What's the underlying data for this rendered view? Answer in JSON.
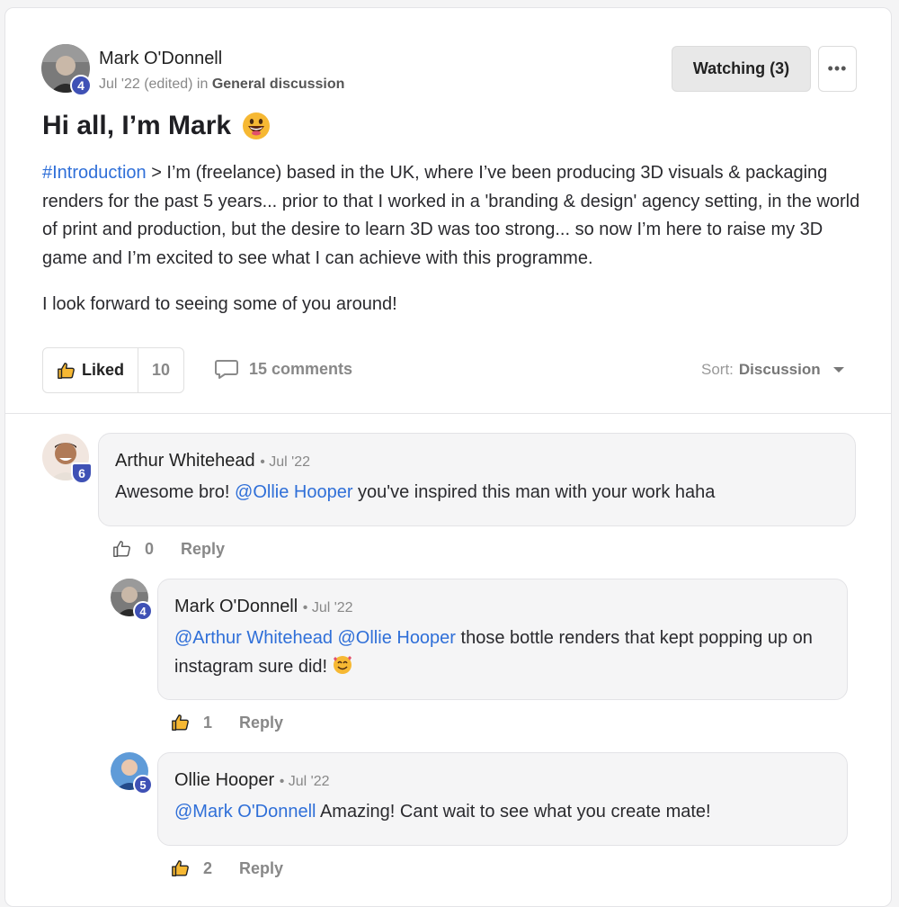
{
  "post": {
    "author": "Mark O'Donnell",
    "author_level": "4",
    "date": "Jul '22 (edited)",
    "in_label": "in",
    "category": "General discussion",
    "watch_label": "Watching (3)",
    "more_label": "•••",
    "title": "Hi all, I’m Mark",
    "hashtag": "#Introduction",
    "body_rest": " > I’m (freelance) based in the UK, where I’ve been producing 3D visuals & packaging renders for the past 5 years... prior to that I worked in a 'branding & design' agency setting, in the world of print and production, but the desire to learn 3D was too strong... so now I’m here to raise my 3D game and I’m excited to see what I can achieve with this programme.",
    "body_second": "I look forward to seeing some of you around!",
    "liked_label": "Liked",
    "like_count": "10",
    "comments_label": "15 comments",
    "sort_prefix": "Sort:",
    "sort_value": "Discussion"
  },
  "comments": [
    {
      "author": "Arthur Whitehead",
      "date": "• Jul '22",
      "level": "6",
      "mention1": "",
      "mention2": "@Ollie Hooper",
      "text_before": "Awesome bro! ",
      "text_after": " you've inspired this man with your work haha",
      "likes": "0",
      "reply_label": "Reply"
    },
    {
      "author": "Mark O'Donnell",
      "date": "• Jul '22",
      "level": "4",
      "mention1": "@Arthur Whitehead",
      "mention2": "@Ollie Hooper",
      "text_after": " those bottle renders that kept popping up on instagram sure did!",
      "likes": "1",
      "reply_label": "Reply"
    },
    {
      "author": "Ollie Hooper",
      "date": "• Jul '22",
      "level": "5",
      "mention1": "@Mark O'Donnell",
      "text_after": " Amazing! Cant wait to see what you create mate!",
      "likes": "2",
      "reply_label": "Reply"
    }
  ],
  "colors": {
    "accent": "#2f6fd8",
    "badge": "#3f51b5"
  }
}
